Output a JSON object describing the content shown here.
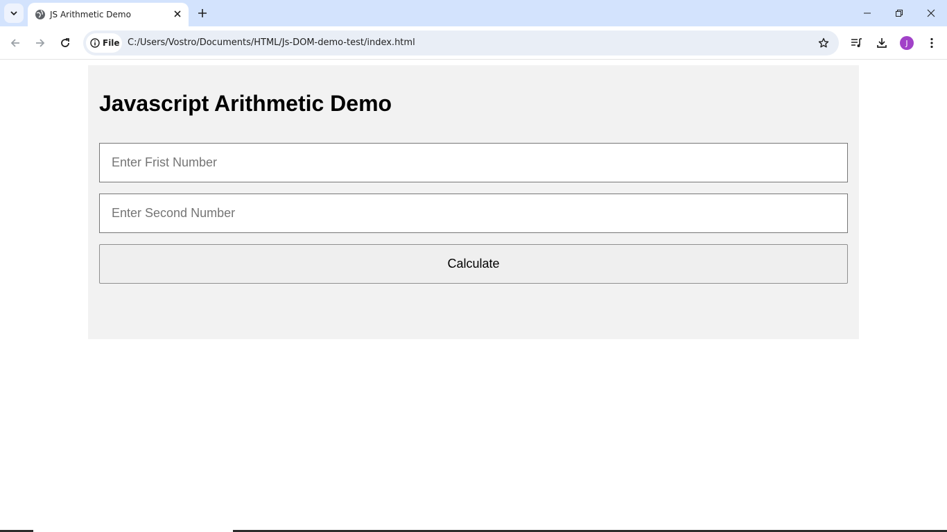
{
  "browser": {
    "tab": {
      "title": "JS Arithmetic Demo"
    },
    "site_chip_label": "File",
    "url": "C:/Users/Vostro/Documents/HTML/Js-DOM-demo-test/index.html",
    "profile_initial": "J",
    "profile_color": "#a142c8"
  },
  "page": {
    "heading": "Javascript Arithmetic Demo",
    "first_input": {
      "placeholder": "Enter Frist Number",
      "value": ""
    },
    "second_input": {
      "placeholder": "Enter Second Number",
      "value": ""
    },
    "calculate_label": "Calculate"
  },
  "colors": {
    "tabstrip_bg": "#d3e3fd",
    "container_bg": "#f2f2f2",
    "button_bg": "#efefef"
  }
}
